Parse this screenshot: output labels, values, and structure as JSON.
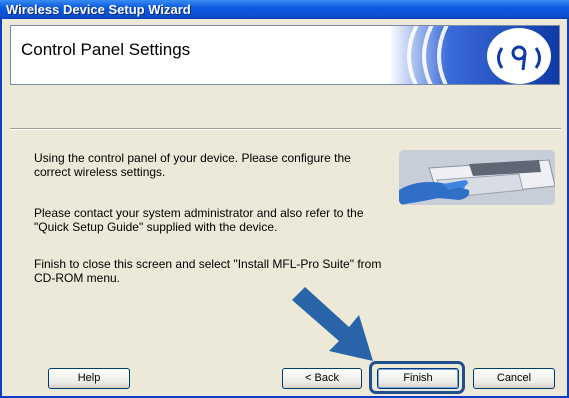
{
  "window": {
    "title": "Wireless Device Setup Wizard"
  },
  "banner": {
    "title": "Control Panel Settings",
    "logo_icon": "wireless-signal-icon"
  },
  "content": {
    "paragraph1": "Using the control panel of your device. Please configure the correct wireless settings.",
    "paragraph2": "Please contact your system administrator and also refer to the \"Quick Setup Guide\" supplied with the device.",
    "paragraph3": "Finish to close this screen and select \"Install MFL-Pro Suite\" from CD-ROM menu.",
    "device_image": "printer-control-panel-hand"
  },
  "buttons": {
    "help": "Help",
    "back": "< Back",
    "finish": "Finish",
    "cancel": "Cancel"
  },
  "annotation": {
    "arrow_color": "#2a64a8",
    "highlight_color": "#1f4f8c"
  }
}
